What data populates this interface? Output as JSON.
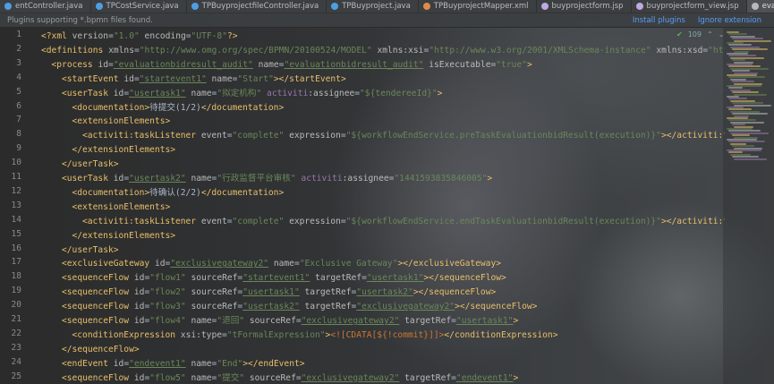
{
  "tabs": [
    {
      "label": "entController.java",
      "color": "#4f9ee3"
    },
    {
      "label": "TPCostService.java",
      "color": "#4f9ee3"
    },
    {
      "label": "TPBuyprojectfileController.java",
      "color": "#4f9ee3"
    },
    {
      "label": "TPBuyproject.java",
      "color": "#4f9ee3"
    },
    {
      "label": "TPBuyprojectMapper.xml",
      "color": "#e08a4a"
    },
    {
      "label": "buyprojectform.jsp",
      "color": "#c0a8e0"
    },
    {
      "label": "buyprojectform_view.jsp",
      "color": "#c0a8e0"
    },
    {
      "label": "evaluationbidresult_audit.bpmn",
      "color": "#b8b8b8",
      "active": true
    }
  ],
  "notice": {
    "message": "Plugins supporting *.bpmn files found.",
    "install": "Install plugins",
    "ignore": "Ignore extension"
  },
  "inspection": {
    "count": "109",
    "up": "⌃",
    "down": "⌄"
  },
  "line_numbers": [
    "1",
    "2",
    "3",
    "4",
    "5",
    "6",
    "7",
    "8",
    "9",
    "10",
    "11",
    "12",
    "13",
    "14",
    "15",
    "16",
    "17",
    "18",
    "19",
    "20",
    "21",
    "22",
    "23",
    "24",
    "25"
  ],
  "code_lines": [
    {
      "indent": 0,
      "parts": [
        [
          "pi",
          "<?xml "
        ],
        [
          "attr",
          "version"
        ],
        [
          "text",
          "="
        ],
        [
          "val",
          "\"1.0\""
        ],
        [
          "text",
          " "
        ],
        [
          "attr",
          "encoding"
        ],
        [
          "text",
          "="
        ],
        [
          "val",
          "\"UTF-8\""
        ],
        [
          "pi",
          "?>"
        ]
      ]
    },
    {
      "indent": 0,
      "parts": [
        [
          "tag",
          "<definitions "
        ],
        [
          "attr",
          "xmlns"
        ],
        [
          "text",
          "="
        ],
        [
          "val",
          "\"http://www.omg.org/spec/BPMN/20100524/MODEL\""
        ],
        [
          "text",
          " "
        ],
        [
          "attr",
          "xmlns:xsi"
        ],
        [
          "text",
          "="
        ],
        [
          "val",
          "\"http://www.w3.org/2001/XMLSchema-instance\""
        ],
        [
          "text",
          " "
        ],
        [
          "attr",
          "xmlns:xsd"
        ],
        [
          "text",
          "="
        ],
        [
          "val",
          "\"http"
        ]
      ]
    },
    {
      "indent": 1,
      "parts": [
        [
          "tag",
          "<process "
        ],
        [
          "attr",
          "id"
        ],
        [
          "text",
          "="
        ],
        [
          "val",
          "\"evaluationbidresult_audit\""
        ],
        [
          "text",
          " "
        ],
        [
          "attr",
          "name"
        ],
        [
          "text",
          "="
        ],
        [
          "val",
          "\"evaluationbidresult_audit\""
        ],
        [
          "text",
          " "
        ],
        [
          "attr",
          "isExecutable"
        ],
        [
          "text",
          "="
        ],
        [
          "val",
          "\"true\""
        ],
        [
          "tag",
          ">"
        ]
      ]
    },
    {
      "indent": 2,
      "parts": [
        [
          "tag",
          "<startEvent "
        ],
        [
          "attr",
          "id"
        ],
        [
          "text",
          "="
        ],
        [
          "val",
          "\"startevent1\""
        ],
        [
          "text",
          " "
        ],
        [
          "attr",
          "name"
        ],
        [
          "text",
          "="
        ],
        [
          "val",
          "\"Start\""
        ],
        [
          "tag",
          "></startEvent>"
        ]
      ]
    },
    {
      "indent": 2,
      "parts": [
        [
          "tag",
          "<userTask "
        ],
        [
          "attr",
          "id"
        ],
        [
          "text",
          "="
        ],
        [
          "val",
          "\"usertask1\""
        ],
        [
          "text",
          " "
        ],
        [
          "attr",
          "name"
        ],
        [
          "text",
          "="
        ],
        [
          "val",
          "\"拟定机构\""
        ],
        [
          "text",
          " "
        ],
        [
          "ns",
          "activiti"
        ],
        [
          "attr",
          ":assignee"
        ],
        [
          "text",
          "="
        ],
        [
          "val",
          "\"${tendereeId}\""
        ],
        [
          "tag",
          ">"
        ]
      ]
    },
    {
      "indent": 3,
      "parts": [
        [
          "tag",
          "<documentation>"
        ],
        [
          "text",
          "待提交(1/2)"
        ],
        [
          "tag",
          "</documentation>"
        ]
      ]
    },
    {
      "indent": 3,
      "parts": [
        [
          "tag",
          "<extensionElements>"
        ]
      ]
    },
    {
      "indent": 4,
      "parts": [
        [
          "tag",
          "<activiti:taskListener "
        ],
        [
          "attr",
          "event"
        ],
        [
          "text",
          "="
        ],
        [
          "val",
          "\"complete\""
        ],
        [
          "text",
          " "
        ],
        [
          "attr",
          "expression"
        ],
        [
          "text",
          "="
        ],
        [
          "val",
          "\"${workflowEndService.preTaskEvaluationbidResult(execution)}\""
        ],
        [
          "tag",
          "></activiti:ta"
        ]
      ]
    },
    {
      "indent": 3,
      "parts": [
        [
          "tag",
          "</extensionElements>"
        ]
      ]
    },
    {
      "indent": 2,
      "parts": [
        [
          "tag",
          "</userTask>"
        ]
      ]
    },
    {
      "indent": 2,
      "parts": [
        [
          "tag",
          "<userTask "
        ],
        [
          "attr",
          "id"
        ],
        [
          "text",
          "="
        ],
        [
          "val",
          "\"usertask2\""
        ],
        [
          "text",
          " "
        ],
        [
          "attr",
          "name"
        ],
        [
          "text",
          "="
        ],
        [
          "val",
          "\"行政监督平台审核\""
        ],
        [
          "text",
          " "
        ],
        [
          "ns",
          "activiti"
        ],
        [
          "attr",
          ":assignee"
        ],
        [
          "text",
          "="
        ],
        [
          "val",
          "\"1441593835846005\""
        ],
        [
          "tag",
          ">"
        ]
      ]
    },
    {
      "indent": 3,
      "parts": [
        [
          "tag",
          "<documentation>"
        ],
        [
          "text",
          "待确认(2/2)"
        ],
        [
          "tag",
          "</documentation>"
        ]
      ]
    },
    {
      "indent": 3,
      "parts": [
        [
          "tag",
          "<extensionElements>"
        ]
      ]
    },
    {
      "indent": 4,
      "parts": [
        [
          "tag",
          "<activiti:taskListener "
        ],
        [
          "attr",
          "event"
        ],
        [
          "text",
          "="
        ],
        [
          "val",
          "\"complete\""
        ],
        [
          "text",
          " "
        ],
        [
          "attr",
          "expression"
        ],
        [
          "text",
          "="
        ],
        [
          "val",
          "\"${workflowEndService.endTaskEvaluationbidResult(execution)}\""
        ],
        [
          "tag",
          "></activiti:ta"
        ]
      ]
    },
    {
      "indent": 3,
      "parts": [
        [
          "tag",
          "</extensionElements>"
        ]
      ]
    },
    {
      "indent": 2,
      "parts": [
        [
          "tag",
          "</userTask>"
        ]
      ]
    },
    {
      "indent": 2,
      "parts": [
        [
          "tag",
          "<exclusiveGateway "
        ],
        [
          "attr",
          "id"
        ],
        [
          "text",
          "="
        ],
        [
          "val",
          "\"exclusivegateway2\""
        ],
        [
          "text",
          " "
        ],
        [
          "attr",
          "name"
        ],
        [
          "text",
          "="
        ],
        [
          "val",
          "\"Exclusive Gateway\""
        ],
        [
          "tag",
          "></exclusiveGateway>"
        ]
      ]
    },
    {
      "indent": 2,
      "parts": [
        [
          "tag",
          "<sequenceFlow "
        ],
        [
          "attr",
          "id"
        ],
        [
          "text",
          "="
        ],
        [
          "val",
          "\"flow1\""
        ],
        [
          "text",
          " "
        ],
        [
          "attr",
          "sourceRef"
        ],
        [
          "text",
          "="
        ],
        [
          "val",
          "\"startevent1\""
        ],
        [
          "text",
          " "
        ],
        [
          "attr",
          "targetRef"
        ],
        [
          "text",
          "="
        ],
        [
          "val",
          "\"usertask1\""
        ],
        [
          "tag",
          "></sequenceFlow>"
        ]
      ]
    },
    {
      "indent": 2,
      "parts": [
        [
          "tag",
          "<sequenceFlow "
        ],
        [
          "attr",
          "id"
        ],
        [
          "text",
          "="
        ],
        [
          "val",
          "\"flow2\""
        ],
        [
          "text",
          " "
        ],
        [
          "attr",
          "sourceRef"
        ],
        [
          "text",
          "="
        ],
        [
          "val",
          "\"usertask1\""
        ],
        [
          "text",
          " "
        ],
        [
          "attr",
          "targetRef"
        ],
        [
          "text",
          "="
        ],
        [
          "val",
          "\"usertask2\""
        ],
        [
          "tag",
          "></sequenceFlow>"
        ]
      ]
    },
    {
      "indent": 2,
      "parts": [
        [
          "tag",
          "<sequenceFlow "
        ],
        [
          "attr",
          "id"
        ],
        [
          "text",
          "="
        ],
        [
          "val",
          "\"flow3\""
        ],
        [
          "text",
          " "
        ],
        [
          "attr",
          "sourceRef"
        ],
        [
          "text",
          "="
        ],
        [
          "val",
          "\"usertask2\""
        ],
        [
          "text",
          " "
        ],
        [
          "attr",
          "targetRef"
        ],
        [
          "text",
          "="
        ],
        [
          "val",
          "\"exclusivegateway2\""
        ],
        [
          "tag",
          "></sequenceFlow>"
        ]
      ]
    },
    {
      "indent": 2,
      "parts": [
        [
          "tag",
          "<sequenceFlow "
        ],
        [
          "attr",
          "id"
        ],
        [
          "text",
          "="
        ],
        [
          "val",
          "\"flow4\""
        ],
        [
          "text",
          " "
        ],
        [
          "attr",
          "name"
        ],
        [
          "text",
          "="
        ],
        [
          "val",
          "\"退回\""
        ],
        [
          "text",
          " "
        ],
        [
          "attr",
          "sourceRef"
        ],
        [
          "text",
          "="
        ],
        [
          "val",
          "\"exclusivegateway2\""
        ],
        [
          "text",
          " "
        ],
        [
          "attr",
          "targetRef"
        ],
        [
          "text",
          "="
        ],
        [
          "val",
          "\"usertask1\""
        ],
        [
          "tag",
          ">"
        ]
      ]
    },
    {
      "indent": 3,
      "parts": [
        [
          "tag",
          "<conditionExpression "
        ],
        [
          "attr",
          "xsi:type"
        ],
        [
          "text",
          "="
        ],
        [
          "val",
          "\"tFormalExpression\""
        ],
        [
          "tag",
          ">"
        ],
        [
          "cdata",
          "<![CDATA[${!commit}]]>"
        ],
        [
          "tag",
          "</conditionExpression>"
        ]
      ]
    },
    {
      "indent": 2,
      "parts": [
        [
          "tag",
          "</sequenceFlow>"
        ]
      ]
    },
    {
      "indent": 2,
      "parts": [
        [
          "tag",
          "<endEvent "
        ],
        [
          "attr",
          "id"
        ],
        [
          "text",
          "="
        ],
        [
          "val",
          "\"endevent1\""
        ],
        [
          "text",
          " "
        ],
        [
          "attr",
          "name"
        ],
        [
          "text",
          "="
        ],
        [
          "val",
          "\"End\""
        ],
        [
          "tag",
          "></endEvent>"
        ]
      ]
    },
    {
      "indent": 2,
      "parts": [
        [
          "tag",
          "<sequenceFlow "
        ],
        [
          "attr",
          "id"
        ],
        [
          "text",
          "="
        ],
        [
          "val",
          "\"flow5\""
        ],
        [
          "text",
          " "
        ],
        [
          "attr",
          "name"
        ],
        [
          "text",
          "="
        ],
        [
          "val",
          "\"提交\""
        ],
        [
          "text",
          " "
        ],
        [
          "attr",
          "sourceRef"
        ],
        [
          "text",
          "="
        ],
        [
          "val",
          "\"exclusivegateway2\""
        ],
        [
          "text",
          " "
        ],
        [
          "attr",
          "targetRef"
        ],
        [
          "text",
          "="
        ],
        [
          "val",
          "\"endevent1\""
        ],
        [
          "tag",
          ">"
        ]
      ]
    }
  ]
}
